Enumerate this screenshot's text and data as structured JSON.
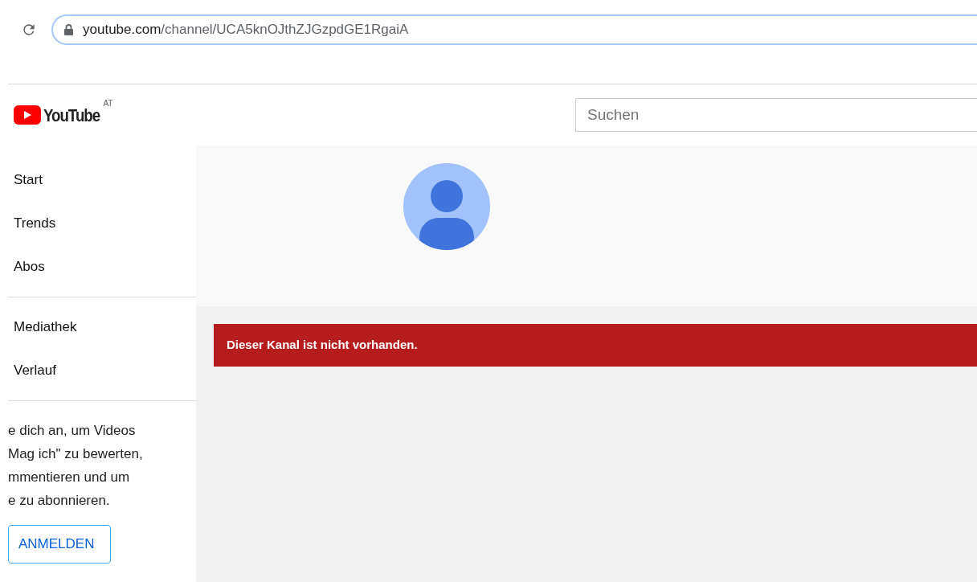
{
  "browser": {
    "url_host": "youtube.com",
    "url_path": "/channel/UCA5knOJthZJGzpdGE1RgaiA"
  },
  "header": {
    "logo_text": "YouTube",
    "region": "AT",
    "search": {
      "placeholder": "Suchen"
    }
  },
  "sidebar": {
    "sections": [
      {
        "items": [
          "Start",
          "Trends",
          "Abos"
        ]
      },
      {
        "items": [
          "Mediathek",
          "Verlauf"
        ]
      }
    ],
    "signin_lines": [
      "e dich an, um Videos",
      "Mag ich\" zu bewerten,",
      "mmentieren und um",
      "e zu abonnieren."
    ],
    "signin_button": "ANMELDEN"
  },
  "alert": {
    "text": "Dieser Kanal ist nicht vorhanden."
  }
}
